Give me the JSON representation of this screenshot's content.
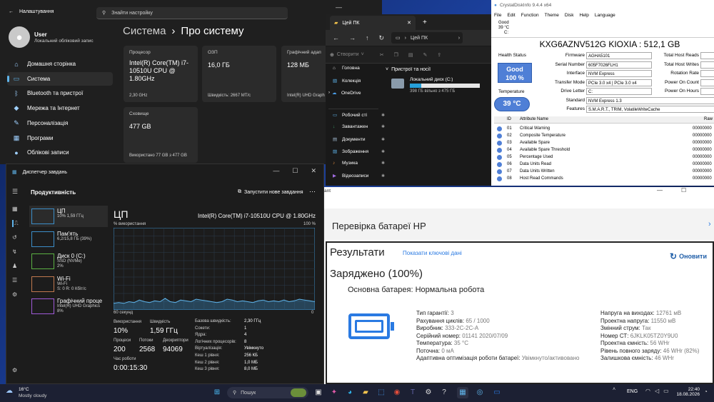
{
  "settings": {
    "title": "Налаштування",
    "search_placeholder": "Знайти настройку",
    "user_name": "User",
    "user_sub": "Локальний обліковий запис",
    "breadcrumb_root": "Система",
    "breadcrumb_sep": "›",
    "breadcrumb_page": "Про систему",
    "nav": [
      {
        "label": "Домашня сторінка",
        "icon": "home-icon",
        "glyph": "⌂"
      },
      {
        "label": "Система",
        "icon": "system-icon",
        "glyph": "▭"
      },
      {
        "label": "Bluetooth та пристрої",
        "icon": "bluetooth-icon",
        "glyph": "ᛒ"
      },
      {
        "label": "Мережа та Інтернет",
        "icon": "network-icon",
        "glyph": "◆"
      },
      {
        "label": "Персоналізація",
        "icon": "brush-icon",
        "glyph": "✎"
      },
      {
        "label": "Програми",
        "icon": "apps-icon",
        "glyph": "▦"
      },
      {
        "label": "Облікові записи",
        "icon": "accounts-icon",
        "glyph": "●"
      }
    ],
    "cards": {
      "cpu": {
        "label": "Процесор",
        "value": "Intel(R) Core(TM) i7-10510U CPU @ 1.80GHz",
        "sub": "2,30 GHz"
      },
      "ram": {
        "label": "ОЗП",
        "value": "16,0 ГБ",
        "sub": "Швидкість: 2667 МТ/с"
      },
      "gpu": {
        "label": "Графічний адап",
        "value": "128 МБ",
        "sub": "Intel(R) UHD Graph"
      },
      "storage": {
        "label": "Сховище",
        "value": "477 GB",
        "sub": "Використано 77 GB з 477 GB"
      }
    }
  },
  "explorer": {
    "tab_title": "Цей ПК",
    "address": "Цей ПК",
    "create_label": "Створити",
    "section_title": "Пристрої та носії",
    "drive_name": "Локальний диск (C:)",
    "drive_free": "398 ГБ вільно з 475 ГБ",
    "drive_used_fraction": 0.16,
    "nav": [
      "Головна",
      "Колекція",
      "OneDrive",
      "Робочий сті",
      "Завантажен",
      "Документи",
      "Зображення",
      "Музика",
      "Відеозаписи"
    ]
  },
  "cdi": {
    "title": "CrystalDiskInfo 9.4.4 x64",
    "menu": [
      "File",
      "Edit",
      "Function",
      "Theme",
      "Disk",
      "Help",
      "Language"
    ],
    "disk_tab": {
      "status": "Good",
      "temp": "39 °C",
      "letter": "C:"
    },
    "model": "KXG6AZNV512G KIOXIA : 512,1 GB",
    "health_label": "Health Status",
    "health_status": "Good",
    "health_pct": "100 %",
    "temp_label": "Temperature",
    "temp_value": "39 °C",
    "fields": [
      {
        "label": "Firmware",
        "value": "AGHA5101"
      },
      {
        "label": "Serial Number",
        "value": "605F7026FLH1"
      },
      {
        "label": "Interface",
        "value": "NVM Express"
      },
      {
        "label": "Transfer Mode",
        "value": "PCIe 3.0 x4 | PCIe 3.0 x4"
      },
      {
        "label": "Drive Letter",
        "value": "C:"
      },
      {
        "label": "Standard",
        "value": "NVM Express 1.3"
      },
      {
        "label": "Features",
        "value": "S.M.A.R.T., TRIM, VolatileWriteCache"
      }
    ],
    "right_fields": [
      "Total Host Reads",
      "Total Host Writes",
      "Rotation Rate",
      "Power On Count",
      "Power On Hours"
    ],
    "table_head": {
      "id": "ID",
      "attr": "Attribute Name",
      "raw": "Raw"
    },
    "rows": [
      {
        "id": "01",
        "name": "Critical Warning",
        "raw": "00000000"
      },
      {
        "id": "02",
        "name": "Composite Temperature",
        "raw": "00000000"
      },
      {
        "id": "03",
        "name": "Available Spare",
        "raw": "00000000"
      },
      {
        "id": "04",
        "name": "Available Spare Threshold",
        "raw": "00000000"
      },
      {
        "id": "05",
        "name": "Percentage Used",
        "raw": "00000000"
      },
      {
        "id": "06",
        "name": "Data Units Read",
        "raw": "00000000"
      },
      {
        "id": "07",
        "name": "Data Units Written",
        "raw": "00000000"
      },
      {
        "id": "08",
        "name": "Host Read Commands",
        "raw": "00000000"
      }
    ]
  },
  "taskmgr": {
    "title": "Диспетчер завдань",
    "section": "Продуктивність",
    "run_task": "Запустити нове завдання",
    "items": [
      {
        "name": "ЦП",
        "sub": "10% 1,59 ГГц",
        "sub2": ""
      },
      {
        "name": "Пам'ять",
        "sub": "6,2/15,8 ГБ (39%)",
        "sub2": ""
      },
      {
        "name": "Диск 0 (C:)",
        "sub": "SSD (NVMe)",
        "sub2": "2%"
      },
      {
        "name": "Wi-Fi",
        "sub": "Wi-Fi",
        "sub2": "S: 0 R: 0 Кбіт/с"
      },
      {
        "name": "Графічний проце",
        "sub": "Intel(R) UHD Graphics",
        "sub2": "8%"
      }
    ],
    "cpu_title": "ЦП",
    "cpu_model": "Intel(R) Core(TM) i7-10510U CPU @ 1.80GHz",
    "util_label": "% використання",
    "util_max": "100 %",
    "time_label": "60 секунд",
    "time_min": "0",
    "cpu_history": [
      8,
      9,
      8,
      10,
      9,
      12,
      10,
      9,
      11,
      10,
      14,
      10,
      9,
      12,
      11,
      10,
      13,
      12,
      11,
      10,
      9,
      10,
      13,
      12,
      10,
      11,
      10,
      9,
      11,
      12,
      10,
      11,
      10,
      12,
      10,
      11,
      13,
      12,
      11,
      10
    ],
    "stats": {
      "usage_label": "Використання",
      "usage": "10%",
      "speed_label": "Швидкість",
      "speed": "1,59 ГГц",
      "proc_label": "Процеси",
      "proc": "200",
      "threads_label": "Потоки",
      "threads": "2568",
      "handles_label": "Дескриптори",
      "handles": "94069",
      "uptime_label": "Час роботи",
      "uptime": "0:00:15:30"
    },
    "specs": [
      {
        "k": "Базова швидкість:",
        "v": "2,30 ГГц"
      },
      {
        "k": "Сокети:",
        "v": "1"
      },
      {
        "k": "Ядра:",
        "v": "4"
      },
      {
        "k": "Логічних процесорів:",
        "v": "8"
      },
      {
        "k": "Віртуалізація:",
        "v": "Увімкнуто"
      },
      {
        "k": "Кеш 1 рівня:",
        "v": "256 КБ"
      },
      {
        "k": "Кеш 2 рівня:",
        "v": "1,0 МБ"
      },
      {
        "k": "Кеш 3 рівня:",
        "v": "8,0 МБ"
      }
    ]
  },
  "battery": {
    "partial_title": "ant",
    "title": "Перевірка батареї HP",
    "results": "Результати",
    "show_key": "Показати ключові дані",
    "refresh": "Оновити",
    "charged": "Заряджено (100%)",
    "main_status": "Основна батарея: Нормальна робота",
    "left": [
      {
        "k": "Тип гарантії:",
        "v": "3"
      },
      {
        "k": "Рахування циклів:",
        "v": "65 / 1000"
      },
      {
        "k": "Виробник:",
        "v": "333-2C-2C-A"
      },
      {
        "k": "Серійний номер:",
        "v": "01141 2020/07/09"
      },
      {
        "k": "Температура:",
        "v": "35 °C"
      },
      {
        "k": "Поточна:",
        "v": "0 мА"
      },
      {
        "k": "Адаптивна оптимізація роботи батареї:",
        "v": "Увімкнуто/активовано"
      }
    ],
    "right": [
      {
        "k": "Напруга на виходах:",
        "v": "12761 мВ"
      },
      {
        "k": "Проектна напруга:",
        "v": "11550 мВ"
      },
      {
        "k": "Змінний струм:",
        "v": "Так"
      },
      {
        "k": "Номер СТ:",
        "v": "6JKLK05TZ0Y9U0"
      },
      {
        "k": "Проектна ємність:",
        "v": "56 WHr"
      },
      {
        "k": "Рівень повного заряду:",
        "v": "46 WHr (82%)"
      },
      {
        "k": "Залишкова ємність:",
        "v": "46 WHr"
      }
    ]
  },
  "taskbar": {
    "weather_temp": "16°C",
    "weather_text": "Mostly cloudy",
    "search": "Пошук",
    "lang": "ENG",
    "time": "22:40",
    "date": "18.08.2026"
  }
}
